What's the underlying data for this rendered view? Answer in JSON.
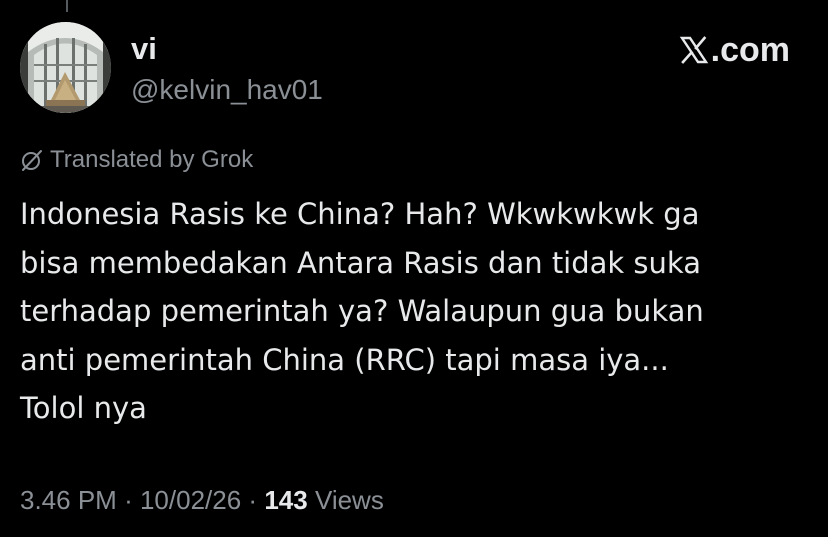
{
  "author": {
    "display_name": "vi",
    "handle": "@kelvin_hav01"
  },
  "brand": {
    "label": ".com",
    "icon": "x-logo-icon"
  },
  "translation": {
    "label": "Translated by Grok",
    "icon": "grok-icon"
  },
  "tweet": {
    "lines": [
      "Indonesia Rasis ke China? Hah? Wkwkwkwk ga",
      "bisa membedakan Antara Rasis dan tidak suka",
      "terhadap pemerintah ya? Walaupun gua bukan",
      "anti pemerintah China (RRC) tapi masa iya...",
      "Tolol nya"
    ]
  },
  "meta": {
    "time": "3.46 PM",
    "separator": "·",
    "date": "10/02/26",
    "views_count": "143",
    "views_label": "Views"
  },
  "colors": {
    "background": "#000000",
    "primary_text": "#e7e9ea",
    "secondary_text": "#8b9096"
  }
}
